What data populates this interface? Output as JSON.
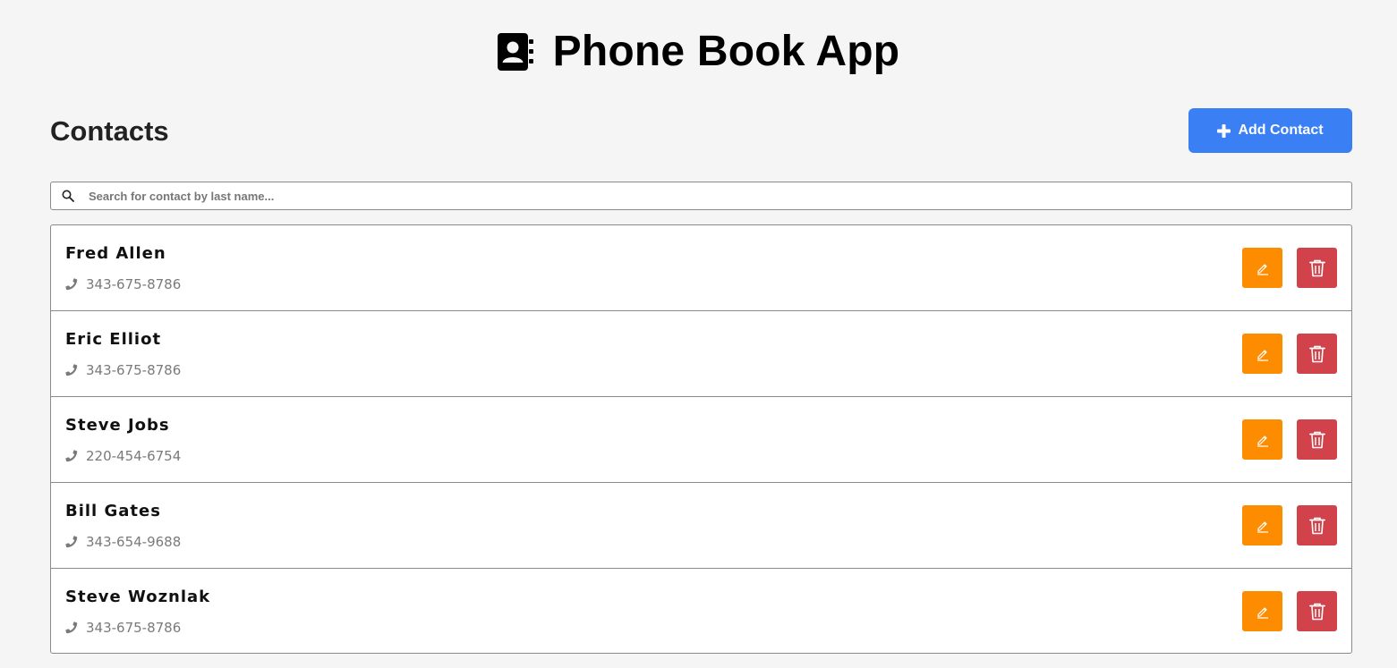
{
  "app": {
    "title": "Phone Book App",
    "logo_icon": "address-book-icon"
  },
  "contacts_section": {
    "heading": "Contacts",
    "add_button_label": "Add Contact",
    "add_icon": "plus-icon"
  },
  "search": {
    "placeholder": "Search for contact by last name...",
    "value": "",
    "icon": "search-icon"
  },
  "contacts": [
    {
      "name": "Fred Allen",
      "phone": "343-675-8786"
    },
    {
      "name": "Eric Elliot",
      "phone": "343-675-8786"
    },
    {
      "name": "Steve Jobs",
      "phone": "220-454-6754"
    },
    {
      "name": "Bill Gates",
      "phone": "343-654-9688"
    },
    {
      "name": "Steve Woznlak",
      "phone": "343-675-8786"
    }
  ],
  "row_actions": {
    "edit_icon": "pencil-icon",
    "delete_icon": "trash-icon"
  },
  "colors": {
    "page_background": "#f5f5f5",
    "primary": "#3b7ff5",
    "edit": "#fd8c00",
    "delete": "#d2424a",
    "phone_text": "#7a7a7a"
  }
}
